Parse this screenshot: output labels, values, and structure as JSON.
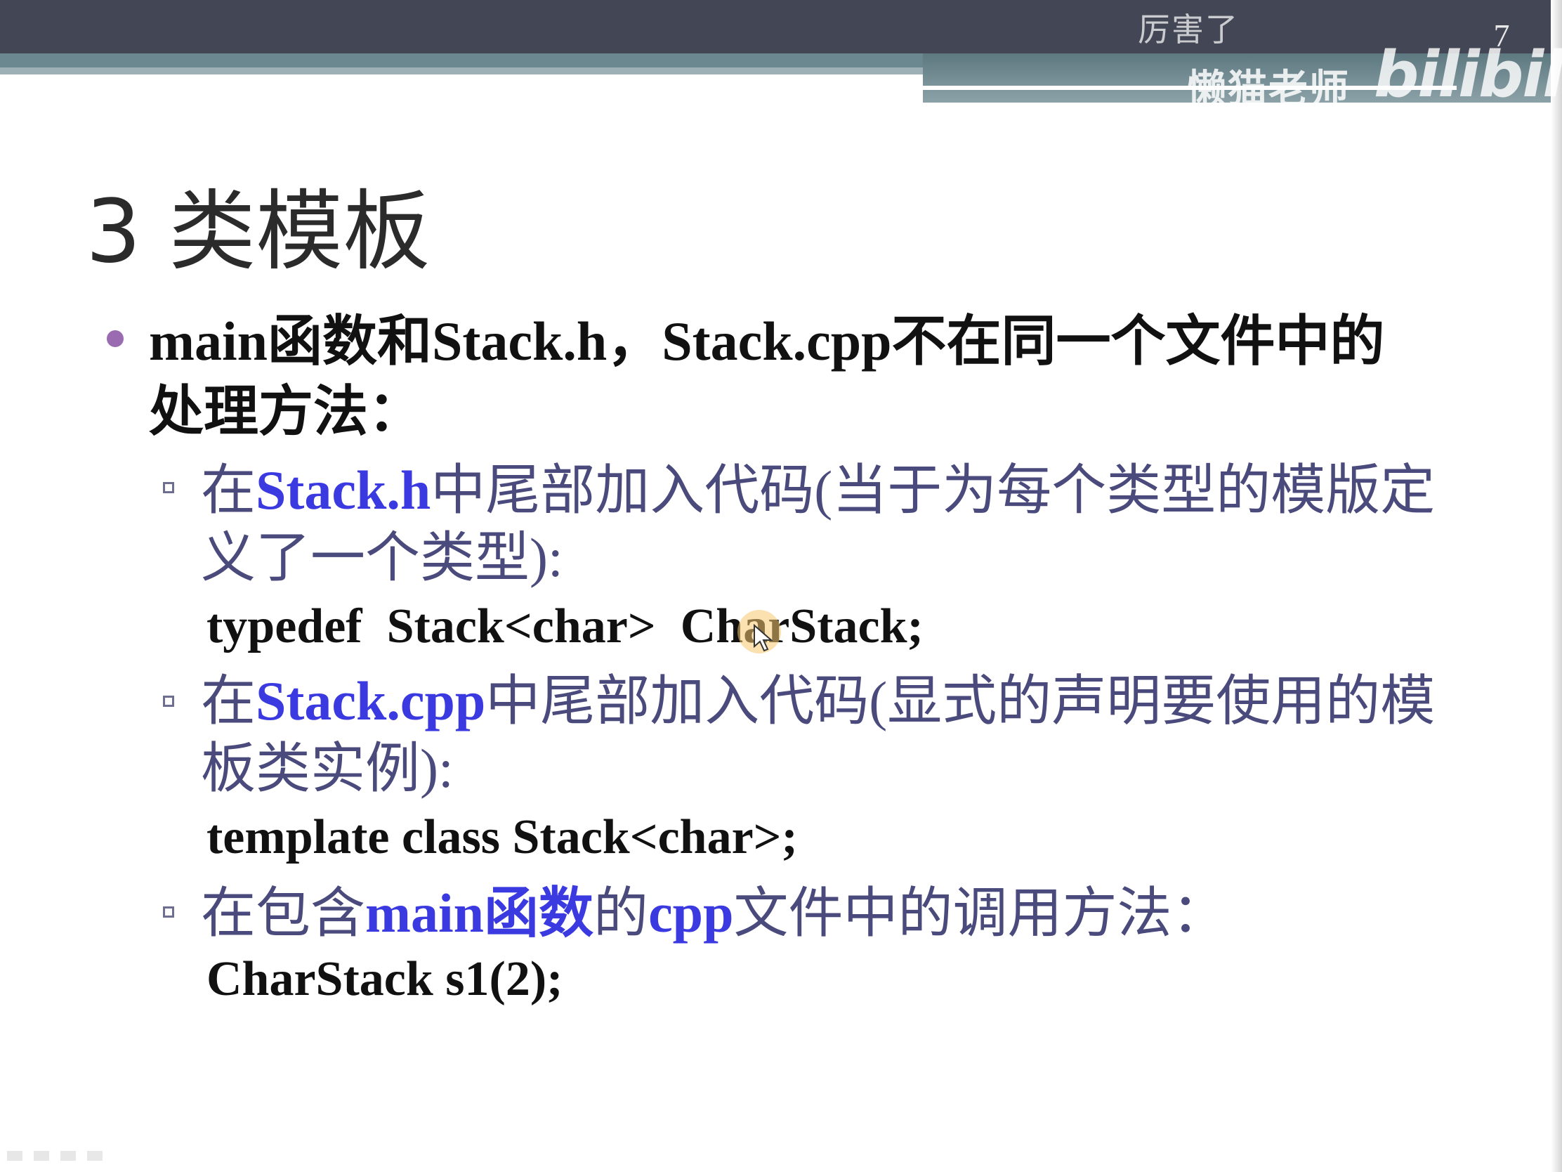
{
  "slide": {
    "page_number": "7",
    "title": "3 类模板",
    "bullet_main": "main函数和Stack.h，Stack.cpp不在同一个文件中的处理方法："
  },
  "subitems": [
    {
      "prefix": "在",
      "keyword": "Stack.h",
      "text": "中尾部加入代码(当于为每个类型的模版定义了一个类型):",
      "code": "typedef  Stack<char>  CharStack;"
    },
    {
      "prefix": "在",
      "keyword": "Stack.cpp",
      "text": "中尾部加入代码(显式的声明要使用的模板类实例):",
      "code": "template class Stack<char>;"
    },
    {
      "prefix": "在包含",
      "keyword": "main函数",
      "middle": "的",
      "keyword2": "cpp",
      "text": "文件中的调用方法：",
      "code": "CharStack s1(2);"
    }
  ],
  "overlay": {
    "danmaku": "厉害了",
    "uploader": "懒猫老师",
    "logo": "bilibili"
  },
  "colors": {
    "top_bar": "#434655",
    "stripe": "#6b8790",
    "bullet": "#9a6bb0",
    "subtext": "#4a4a7c",
    "keyword": "#3a3ae0"
  },
  "icons": {
    "cursor": "mouse-pointer-icon"
  }
}
